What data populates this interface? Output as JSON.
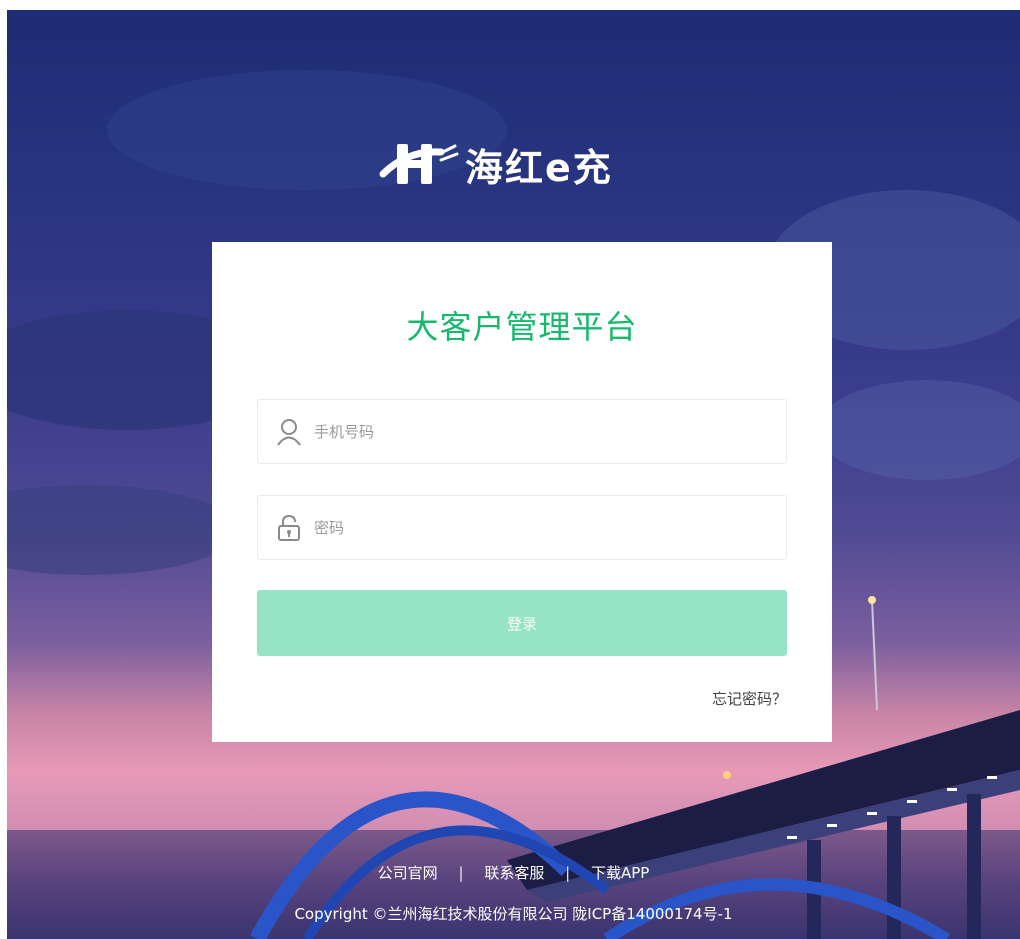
{
  "brand": {
    "logo_text": "海红e充"
  },
  "login": {
    "title": "大客户管理平台",
    "phone_placeholder": "手机号码",
    "password_placeholder": "密码",
    "submit_label": "登录",
    "forgot_label": "忘记密码？"
  },
  "footer": {
    "links": [
      "公司官网",
      "联系客服",
      "下载APP"
    ],
    "separator": "|",
    "copyright": "Copyright ©兰州海红技术股份有限公司 陇ICP备14000174号-1"
  },
  "icons": {
    "phone_field": "user-icon",
    "password_field": "lock-icon"
  },
  "colors": {
    "accent": "#18b86d",
    "button": "#96e3c6",
    "background_top": "#1e2b75",
    "background_bottom": "#e79ab6"
  }
}
